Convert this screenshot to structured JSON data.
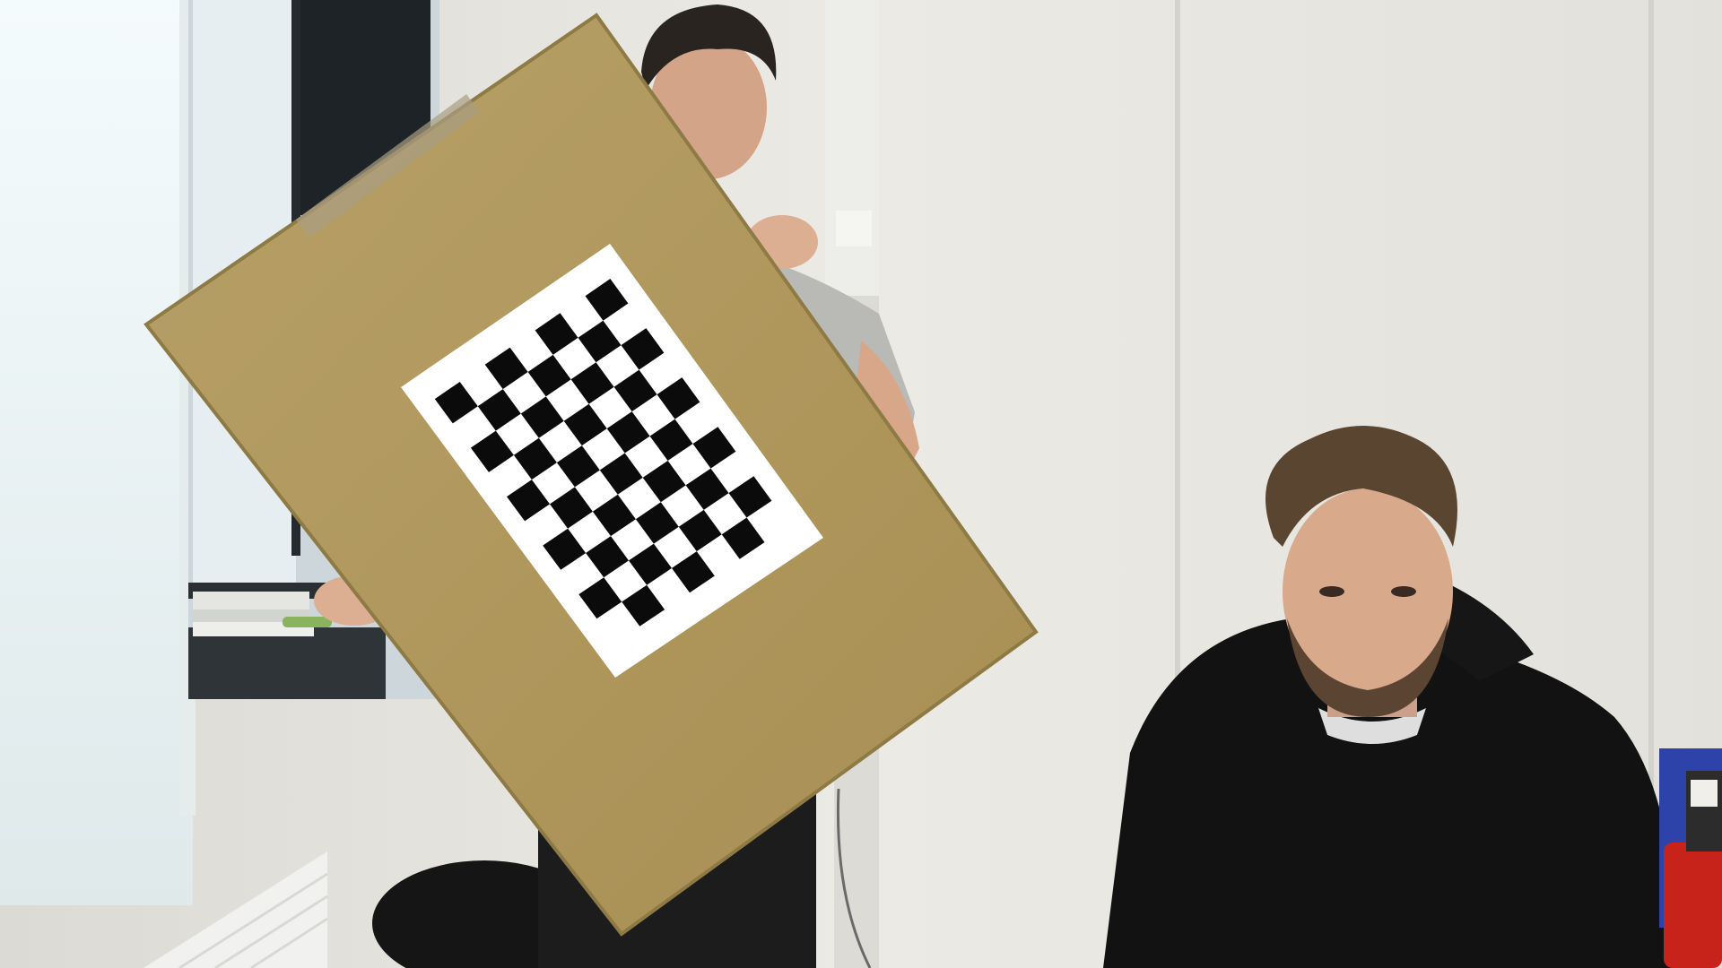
{
  "scene": {
    "colors": {
      "wall": "#e8e6e1",
      "wall_shadow": "#d9d7d1",
      "window_glow": "#eef6f7",
      "window_frame": "#1d2327",
      "board": "#b29a5f",
      "board_edge": "#8e7a45",
      "paper": "#ffffff",
      "checker_dark": "#0b0b0b",
      "hoodie": "#121212",
      "shirt_grey": "#b9b9b6",
      "hair_brown": "#5a4630",
      "skin": "#d9a98c",
      "radiator": "#f1f1ef",
      "flask_red": "#c8231b"
    },
    "checkerboard": {
      "rows": 7,
      "cols": 10
    }
  }
}
